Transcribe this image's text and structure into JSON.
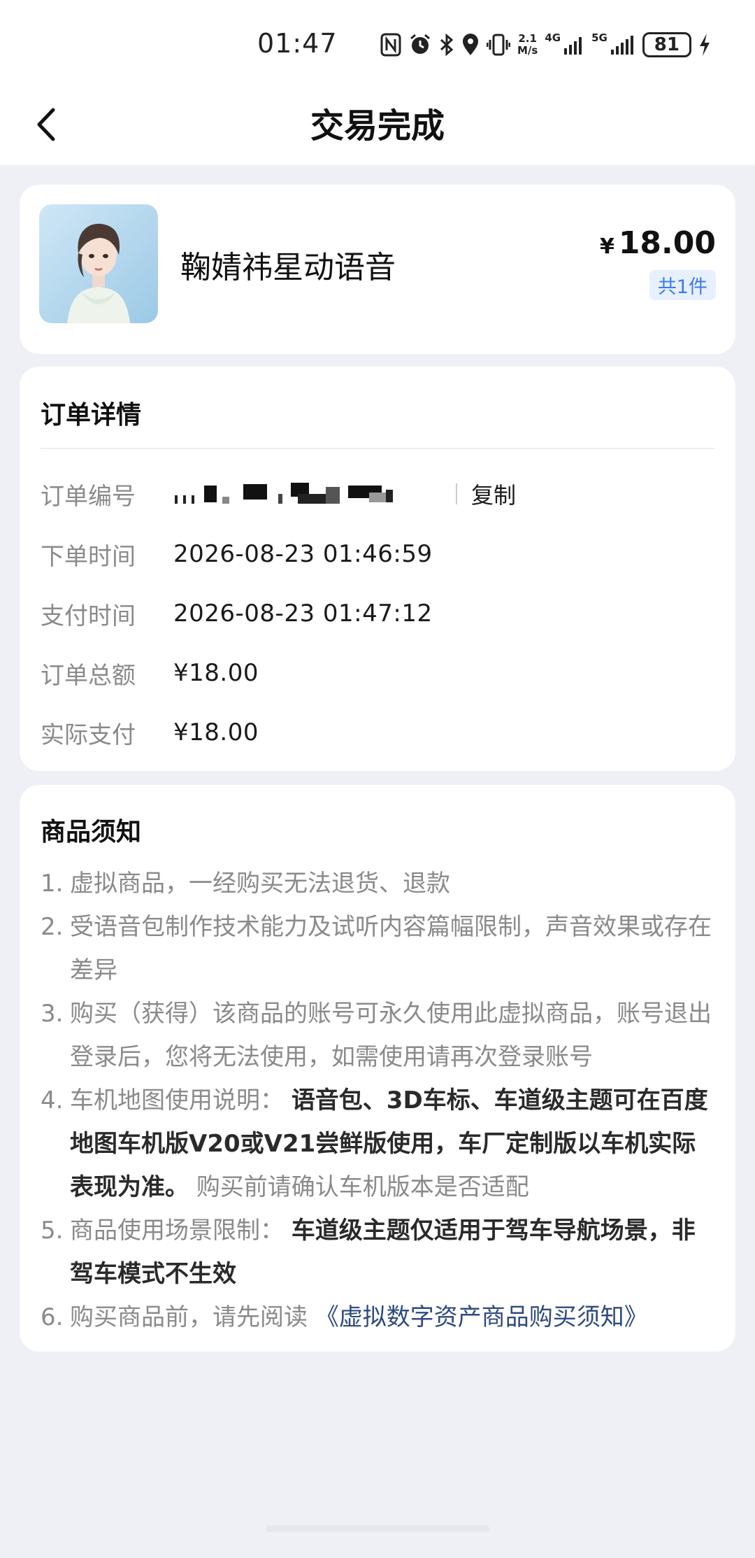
{
  "status_bar": {
    "time": "01:47",
    "net_speed_value": "2.1",
    "net_speed_unit": "M/s",
    "sig1_label": "4G",
    "sig2_label": "5G",
    "battery": "81",
    "icons": [
      "nfc-icon",
      "alarm-icon",
      "bluetooth-icon",
      "location-icon",
      "vibrate-icon",
      "signal-icon",
      "signal-icon",
      "charging-icon"
    ]
  },
  "header": {
    "title": "交易完成"
  },
  "product": {
    "name": "鞠婧祎星动语音",
    "currency": "¥",
    "price": "18.00",
    "quantity": "共1件"
  },
  "order": {
    "title": "订单详情",
    "rows": [
      {
        "label": "订单编号",
        "value": "",
        "copy_label": "复制"
      },
      {
        "label": "下单时间",
        "value": "2026-08-23 01:46:59"
      },
      {
        "label": "支付时间",
        "value": "2026-08-23 01:47:12"
      },
      {
        "label": "订单总额",
        "value": "¥18.00"
      },
      {
        "label": "实际支付",
        "value": "¥18.00"
      }
    ]
  },
  "notice": {
    "title": "商品须知",
    "items": [
      {
        "num": "1.",
        "text": "虚拟商品，一经购买无法退货、退款"
      },
      {
        "num": "2.",
        "text": "受语音包制作技术能力及试听内容篇幅限制，声音效果或存在差异"
      },
      {
        "num": "3.",
        "text": "购买（获得）该商品的账号可永久使用此虚拟商品，账号退出登录后，您将无法使用，如需使用请再次登录账号"
      },
      {
        "num": "4.",
        "pre": "车机地图使用说明：",
        "strong": "语音包、3D车标、车道级主题可在百度地图车机版V20或V21尝鲜版使用，车厂定制版以车机实际表现为准。",
        "post": "购买前请确认车机版本是否适配"
      },
      {
        "num": "5.",
        "pre": "商品使用场景限制：",
        "strong": "车道级主题仅适用于驾车导航场景，非驾车模式不生效"
      },
      {
        "num": "6.",
        "pre": "购买商品前，请先阅读",
        "link": "《虚拟数字资产商品购买须知》"
      }
    ]
  },
  "colors": {
    "background": "#eef0f6",
    "card": "#ffffff",
    "accent_blue": "#3b7bf0",
    "link": "#2f4a7f",
    "muted": "#8a8a8a"
  }
}
